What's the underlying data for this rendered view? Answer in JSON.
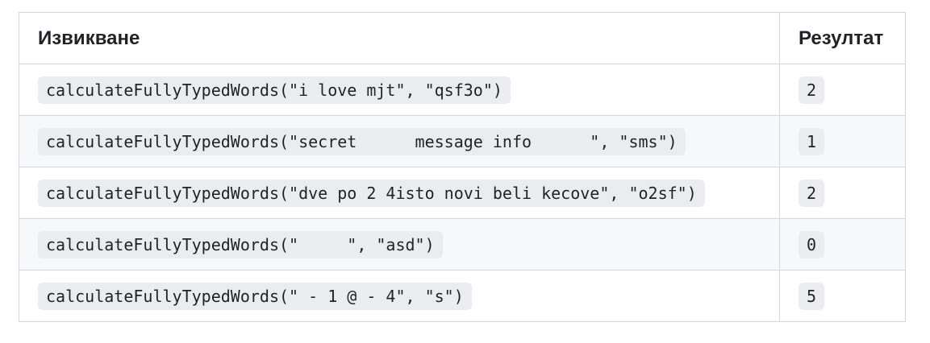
{
  "table": {
    "headers": {
      "call": "Извикване",
      "result": "Резултат"
    },
    "rows": [
      {
        "call": "calculateFullyTypedWords(\"i love mjt\", \"qsf3o\")",
        "result": "2"
      },
      {
        "call": "calculateFullyTypedWords(\"secret      message info      \", \"sms\")",
        "result": "1"
      },
      {
        "call": "calculateFullyTypedWords(\"dve po 2 4isto novi beli kecove\", \"o2sf\")",
        "result": "2"
      },
      {
        "call": "calculateFullyTypedWords(\"     \", \"asd\")",
        "result": "0"
      },
      {
        "call": "calculateFullyTypedWords(\" - 1 @ - 4\", \"s\")",
        "result": "5"
      }
    ]
  }
}
